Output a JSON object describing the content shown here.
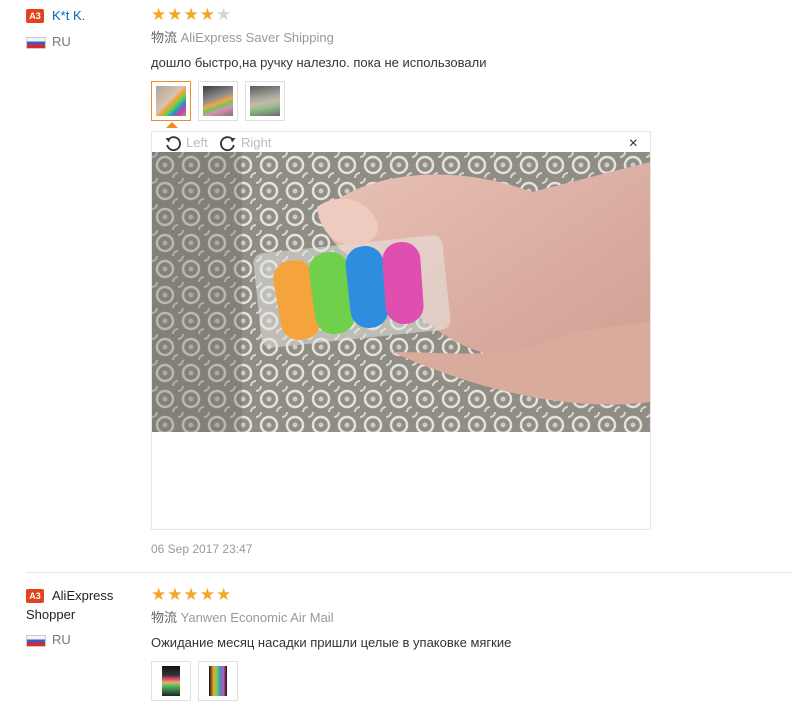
{
  "reviews": [
    {
      "badge": "A3",
      "username": "K*t K.",
      "country": "RU",
      "rating": 4,
      "max_rating": 5,
      "shipping_label": "物流",
      "shipping_method": "AliExpress Saver Shipping",
      "comment": "дошло быстро,на ручку налезло. пока не использовали",
      "photo_count": 3,
      "viewer": {
        "rotate_left_label": "Left",
        "rotate_right_label": "Right",
        "close_label": "×"
      },
      "date": "06 Sep 2017 23:47"
    },
    {
      "badge": "A3",
      "username_line1": "AliExpress",
      "username_line2": "Shopper",
      "country": "RU",
      "rating": 5,
      "max_rating": 5,
      "shipping_label": "物流",
      "shipping_method": "Yanwen Economic Air Mail",
      "comment": "Ожидание месяц насадки пришли целые в упаковке мягкие",
      "photo_count": 2
    }
  ],
  "colors": {
    "badge": "#e4411d",
    "username_link": "#0066c0",
    "star_on": "#f5a623",
    "star_off": "#d5d5d5",
    "active_thumb_border": "#f08a24"
  }
}
